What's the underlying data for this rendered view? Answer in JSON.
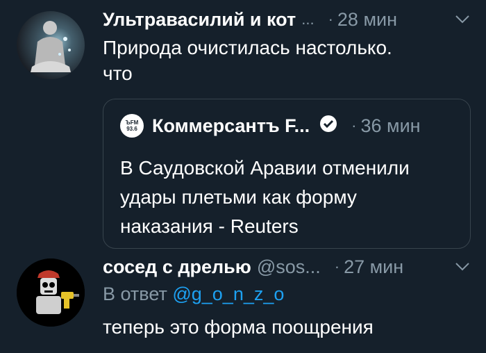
{
  "tweet1": {
    "name": "Ультравасилий и кот",
    "ellipsis": "...",
    "dot": "·",
    "time": "28 мин",
    "text_line1": "Природа очистилась настолько.",
    "text_line2": "что"
  },
  "quote": {
    "logo_line1": "ЪFM",
    "logo_line2": "93.6",
    "name": "Коммерсантъ F...",
    "dot": "·",
    "time": "36 мин",
    "text_line1": "В Саудовской Аравии отменили",
    "text_line2": "удары плетьми как форму",
    "text_line3": "наказания - Reuters"
  },
  "tweet2": {
    "name": "сосед с дрелью",
    "handle": "@sos...",
    "dot": "·",
    "time": "27 мин",
    "reply_prefix": "В ответ",
    "reply_mention": "@g_o_n_z_o",
    "text": "теперь это форма поощрения"
  },
  "colors": {
    "background": "#15202b",
    "secondary_text": "#8899a6",
    "link": "#1da1f2",
    "border": "#38444d"
  },
  "icons": [
    "chevron-down-icon",
    "verified-badge-icon"
  ]
}
